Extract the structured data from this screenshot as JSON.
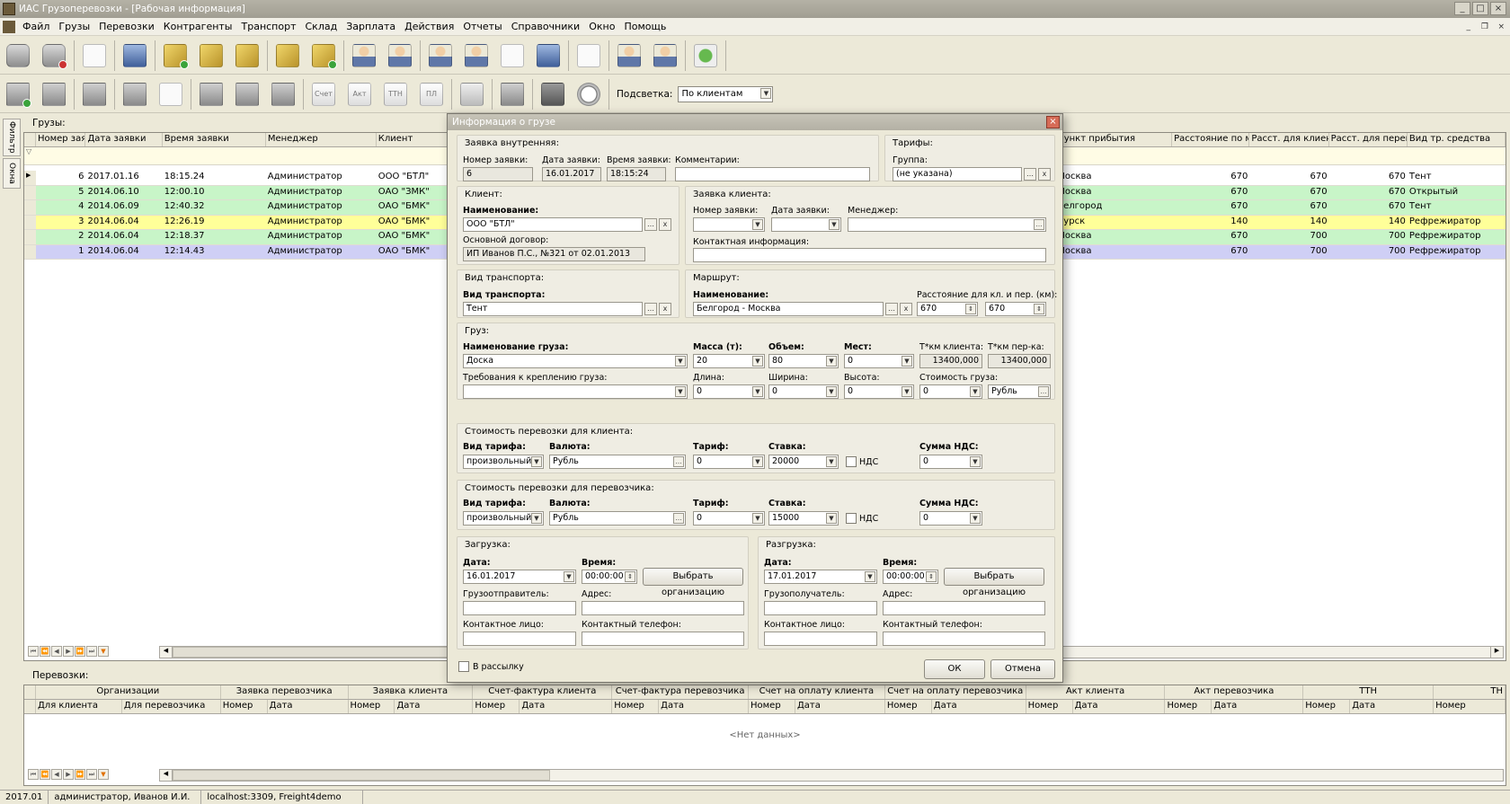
{
  "window": {
    "title": "ИАС Грузоперевозки - [Рабочая информация]"
  },
  "menu": [
    "Файл",
    "Грузы",
    "Перевозки",
    "Контрагенты",
    "Транспорт",
    "Склад",
    "Зарплата",
    "Действия",
    "Отчеты",
    "Справочники",
    "Окно",
    "Помощь"
  ],
  "toolbar2": {
    "doc_labels": [
      "Счет",
      "Акт",
      "ТТН",
      "ПЛ"
    ],
    "highlight_label": "Подсветка:",
    "highlight_value": "По клиентам"
  },
  "sidetabs": [
    "Фильтр",
    "Окна"
  ],
  "cargo": {
    "title": "Грузы:",
    "left_headers": [
      "Номер заявк",
      "Дата заявки",
      "Время заявки",
      "Менеджер",
      "Клиент"
    ],
    "right_headers": [
      "Пункт прибытия",
      "Расстояние по мар",
      "Расст. для клиента",
      "Расст. для перево:",
      "Вид тр. средства"
    ],
    "rows": [
      {
        "num": "6",
        "date": "2017.01.16",
        "time": "18:15.24",
        "manager": "Администратор",
        "client": "ООО \"БТЛ\"",
        "dest": "Москва",
        "dist": "670",
        "dclient": "670",
        "dcarrier": "670",
        "vehicle": "Тент"
      },
      {
        "num": "5",
        "date": "2014.06.10",
        "time": "12:00.10",
        "manager": "Администратор",
        "client": "ОАО \"ЗМК\"",
        "dest": "Москва",
        "dist": "670",
        "dclient": "670",
        "dcarrier": "670",
        "vehicle": "Открытый"
      },
      {
        "num": "4",
        "date": "2014.06.09",
        "time": "12:40.32",
        "manager": "Администратор",
        "client": "ОАО \"БМК\"",
        "dest": "Белгород",
        "dist": "670",
        "dclient": "670",
        "dcarrier": "670",
        "vehicle": "Тент"
      },
      {
        "num": "3",
        "date": "2014.06.04",
        "time": "12:26.19",
        "manager": "Администратор",
        "client": "ОАО \"БМК\"",
        "dest": "Курск",
        "dist": "140",
        "dclient": "140",
        "dcarrier": "140",
        "vehicle": "Рефрежиратор"
      },
      {
        "num": "2",
        "date": "2014.06.04",
        "time": "12:18.37",
        "manager": "Администратор",
        "client": "ОАО \"БМК\"",
        "dest": "Москва",
        "dist": "670",
        "dclient": "700",
        "dcarrier": "700",
        "vehicle": "Рефрежиратор"
      },
      {
        "num": "1",
        "date": "2014.06.04",
        "time": "12:14.43",
        "manager": "Администратор",
        "client": "ОАО \"БМК\"",
        "dest": "Москва",
        "dist": "670",
        "dclient": "700",
        "dcarrier": "700",
        "vehicle": "Рефрежиратор"
      }
    ],
    "row_colors": [
      "#ffffff",
      "#c8f5c8",
      "#c8f5c8",
      "#ffff99",
      "#c8f5c8",
      "#cfcff5"
    ]
  },
  "transport": {
    "title": "Перевозки:",
    "group_headers": [
      "Организации",
      "Заявка перевозчика",
      "Заявка клиента",
      "Счет-фактура клиента",
      "Счет-фактура перевозчика",
      "Счет на оплату клиента",
      "Счет на оплату перевозчика",
      "Акт клиента",
      "Акт перевозчика",
      "ТТН",
      "ТН"
    ],
    "sub_headers": [
      "Для клиента",
      "Для перевозчика",
      "Номер",
      "Дата",
      "Номер",
      "Дата",
      "Номер",
      "Дата",
      "Номер",
      "Дата",
      "Номер",
      "Дата",
      "Номер",
      "Дата",
      "Номер",
      "Дата",
      "Номер",
      "Дата",
      "Номер",
      "Дата",
      "Номер"
    ],
    "empty": "<Нет данных>"
  },
  "status": {
    "period": "2017.01",
    "user": "администратор, Иванов И.И.",
    "db": "localhost:3309, Freight4demo"
  },
  "dialog": {
    "title": "Информация о грузе",
    "internal": {
      "title": "Заявка внутренняя:",
      "num_label": "Номер заявки:",
      "num": "6",
      "date_label": "Дата заявки:",
      "date": "16.01.2017",
      "time_label": "Время заявки:",
      "time": "18:15:24",
      "comment_label": "Комментарии:",
      "comment": ""
    },
    "tariffs": {
      "title": "Тарифы:",
      "group_label": "Группа:",
      "group": "(не указана)"
    },
    "client": {
      "title": "Клиент:",
      "name_label": "Наименование:",
      "name": "ООО \"БТЛ\"",
      "contract_label": "Основной договор:",
      "contract": "ИП Иванов П.С., №321 от 02.01.2013"
    },
    "client_req": {
      "title": "Заявка клиента:",
      "num_label": "Номер заявки:",
      "date_label": "Дата заявки:",
      "manager_label": "Менеджер:",
      "contact_label": "Контактная информация:"
    },
    "vehicle": {
      "title": "Вид транспорта:",
      "label": "Вид транспорта:",
      "value": "Тент"
    },
    "route": {
      "title": "Маршрут:",
      "name_label": "Наименование:",
      "name": "Белгород - Москва",
      "dist_label": "Расстояние для кл. и пер. (км):",
      "dist1": "670",
      "dist2": "670"
    },
    "cargo": {
      "title": "Груз:",
      "name_label": "Наименование груза:",
      "name": "Доска",
      "mass_label": "Масса (т):",
      "mass": "20",
      "vol_label": "Объем:",
      "vol": "80",
      "places_label": "Мест:",
      "places": "0",
      "tkm_client_label": "Т*км клиента:",
      "tkm_client": "13400,000",
      "tkm_carrier_label": "Т*км пер-ка:",
      "tkm_carrier": "13400,000",
      "req_label": "Требования к креплению груза:",
      "len_label": "Длина:",
      "len": "0",
      "wid_label": "Ширина:",
      "wid": "0",
      "hei_label": "Высота:",
      "hei": "0",
      "cost_label": "Стоимость груза:",
      "cost": "0",
      "cost_cur": "Рубль"
    },
    "cost_client": {
      "title": "Стоимость перевозки для клиента:",
      "tariff_type_label": "Вид тарифа:",
      "tariff_type": "произвольный",
      "currency_label": "Валюта:",
      "currency": "Рубль",
      "tariff_label": "Тариф:",
      "tariff": "0",
      "rate_label": "Ставка:",
      "rate": "20000",
      "vat_label": "НДС",
      "vat_sum_label": "Сумма НДС:",
      "vat_sum": "0"
    },
    "cost_carrier": {
      "title": "Стоимость перевозки для перевозчика:",
      "tariff_type_label": "Вид тарифа:",
      "tariff_type": "произвольный",
      "currency_label": "Валюта:",
      "currency": "Рубль",
      "tariff_label": "Тариф:",
      "tariff": "0",
      "rate_label": "Ставка:",
      "rate": "15000",
      "vat_label": "НДС",
      "vat_sum_label": "Сумма НДС:",
      "vat_sum": "0"
    },
    "loading": {
      "title": "Загрузка:",
      "date_label": "Дата:",
      "date": "16.01.2017",
      "time_label": "Время:",
      "time": "00:00:00",
      "choose": "Выбрать организацию",
      "party_label": "Грузоотправитель:",
      "addr_label": "Адрес:",
      "contact_label": "Контактное лицо:",
      "phone_label": "Контактный телефон:"
    },
    "unloading": {
      "title": "Разгрузка:",
      "date_label": "Дата:",
      "date": "17.01.2017",
      "time_label": "Время:",
      "time": "00:00:00",
      "choose": "Выбрать организацию",
      "party_label": "Грузополучатель:",
      "addr_label": "Адрес:",
      "contact_label": "Контактное лицо:",
      "phone_label": "Контактный телефон:"
    },
    "mailing": "В рассылку",
    "ok": "ОК",
    "cancel": "Отмена"
  }
}
